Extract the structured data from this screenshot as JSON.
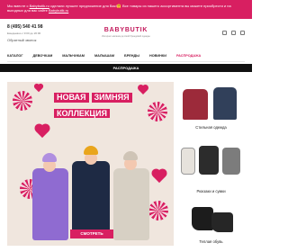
{
  "promo": {
    "text_before_link": "Мы вместе с ",
    "link1": "Babybutik.ru",
    "text_middle": " сделали лучшее предложение для Вас!🤗 Все товары из нашего ассортимента вы можете приобрести и на выгодных для вас сайте ",
    "link2": "Babybutik.ru"
  },
  "header": {
    "phone": "8 (495) 540 41 98",
    "hours": "Ежедневно с 9:00 до 20:00",
    "callback": "Обратный звонок",
    "logo": "BABYBUTIK",
    "logo_tagline": "Интернет-магазин детской брендовой одежды"
  },
  "nav": {
    "items": [
      "КАТАЛОГ",
      "ДЕВОЧКАМ",
      "МАЛЬЧИКАМ",
      "МАЛЫШАМ",
      "БРЕНДЫ",
      "НОВИНКИ",
      "РАСПРОДАЖА"
    ],
    "sub": "РАСПРОДАЖА"
  },
  "banner": {
    "title_line1": [
      "НОВАЯ",
      "ЗИМНЯЯ"
    ],
    "title_line2": "КОЛЛЕКЦИЯ",
    "cta": "СМОТРЕТЬ"
  },
  "side": {
    "cards": [
      {
        "label": "Стильная одежда"
      },
      {
        "label": "Рюкзаки и сумки"
      },
      {
        "label": "Теплая обувь"
      }
    ]
  },
  "colors": {
    "accent": "#d81f61",
    "banner_bg": "#f0e6de"
  }
}
